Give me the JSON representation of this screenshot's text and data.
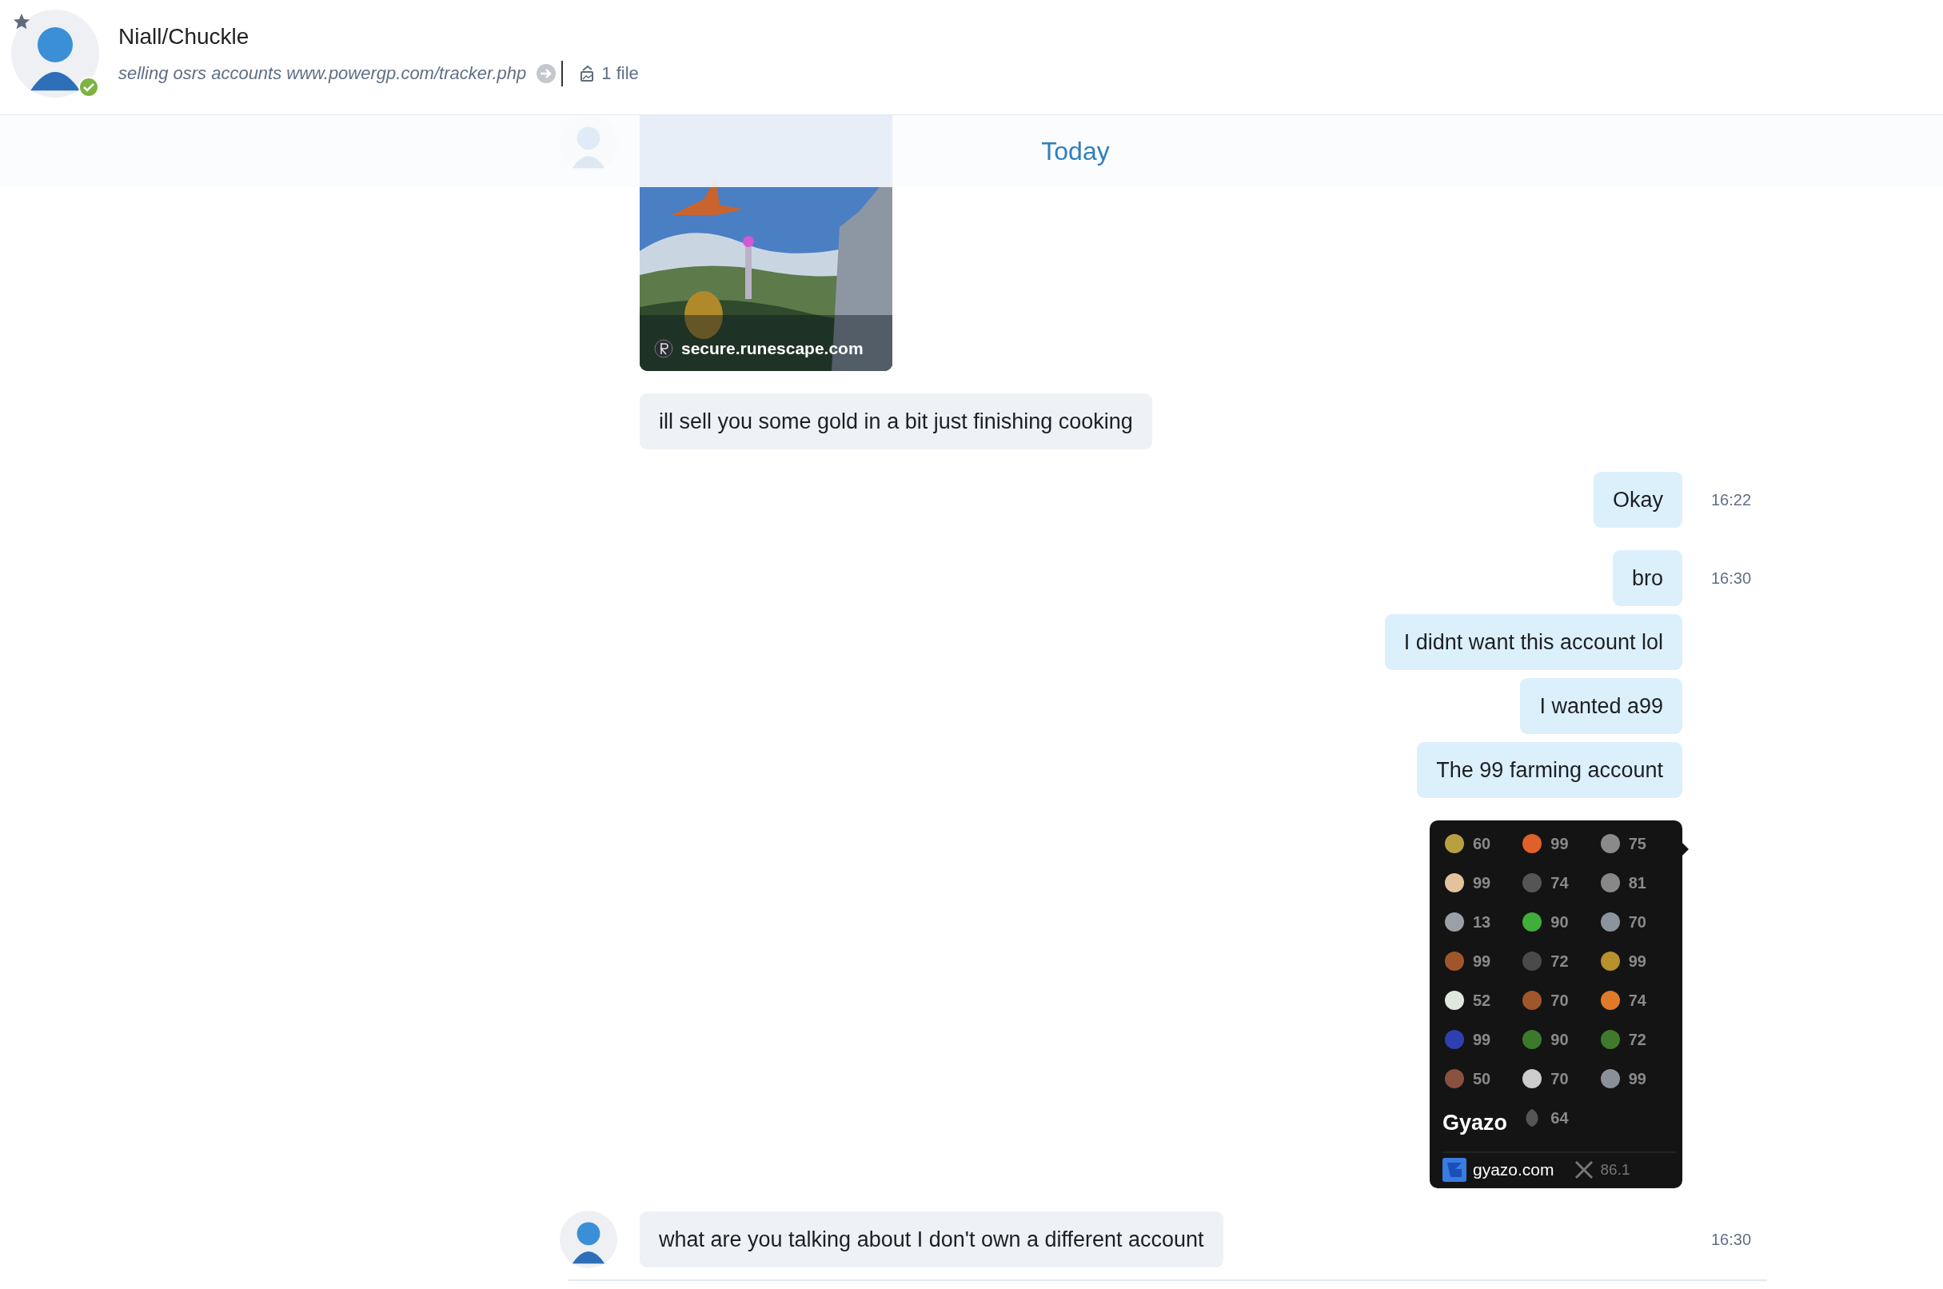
{
  "header": {
    "name": "Niall/Chuckle",
    "status": "selling osrs accounts www.powergp.com/tracker.php",
    "files": "1 file",
    "starred": true,
    "online": true
  },
  "date_label": "Today",
  "messages": [
    {
      "kind": "link_preview",
      "outgoing": false,
      "site": "secure.runescape.com"
    },
    {
      "kind": "text",
      "outgoing": false,
      "text": "ill sell you some gold in a bit just finishing cooking"
    },
    {
      "kind": "text",
      "outgoing": true,
      "text": "Okay",
      "time": "16:22"
    },
    {
      "kind": "text",
      "outgoing": true,
      "text": "bro",
      "time": "16:30"
    },
    {
      "kind": "text",
      "outgoing": true,
      "text": "I didnt want this account lol"
    },
    {
      "kind": "text",
      "outgoing": true,
      "text": "I wanted a99"
    },
    {
      "kind": "text",
      "outgoing": true,
      "text": "The 99 farming account"
    },
    {
      "kind": "stats_image",
      "outgoing": true,
      "stat_rows": [
        [
          "60",
          "99",
          "75"
        ],
        [
          "99",
          "74",
          "81"
        ],
        [
          "13",
          "90",
          "70"
        ],
        [
          "99",
          "72",
          "99"
        ],
        [
          "52",
          "70",
          "74"
        ],
        [
          "99",
          "90",
          "72"
        ],
        [
          "50",
          "70",
          "99"
        ]
      ],
      "partial_row": [
        "64"
      ],
      "total": "86.1",
      "overlay": "Gyazo",
      "site": "gyazo.com"
    },
    {
      "kind": "text",
      "outgoing": false,
      "avatar": true,
      "text": "what are you talking about I don't own a different account",
      "time": "16:30"
    }
  ]
}
